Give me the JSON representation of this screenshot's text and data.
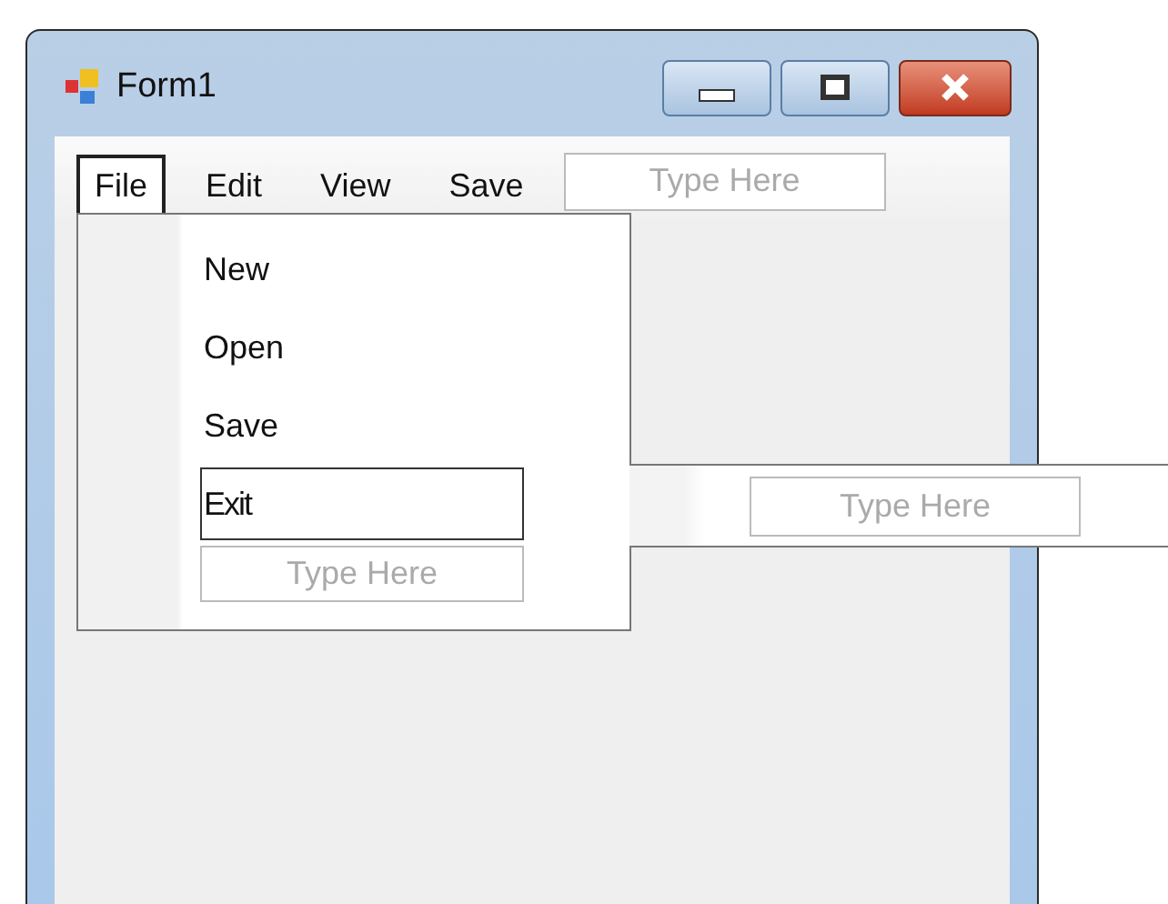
{
  "window": {
    "title": "Form1"
  },
  "menu_bar": {
    "items": [
      {
        "label": "File",
        "selected": true
      },
      {
        "label": "Edit",
        "selected": false
      },
      {
        "label": "View",
        "selected": false
      },
      {
        "label": "Save",
        "selected": false
      }
    ],
    "placeholder": "Type Here"
  },
  "dropdown": {
    "items": [
      {
        "label": "New",
        "selected": false
      },
      {
        "label": "Open",
        "selected": false
      },
      {
        "label": "Save",
        "selected": false
      },
      {
        "label": "Exit",
        "selected": true
      }
    ],
    "placeholder": "Type Here"
  },
  "submenu": {
    "placeholder": "Type Here"
  }
}
